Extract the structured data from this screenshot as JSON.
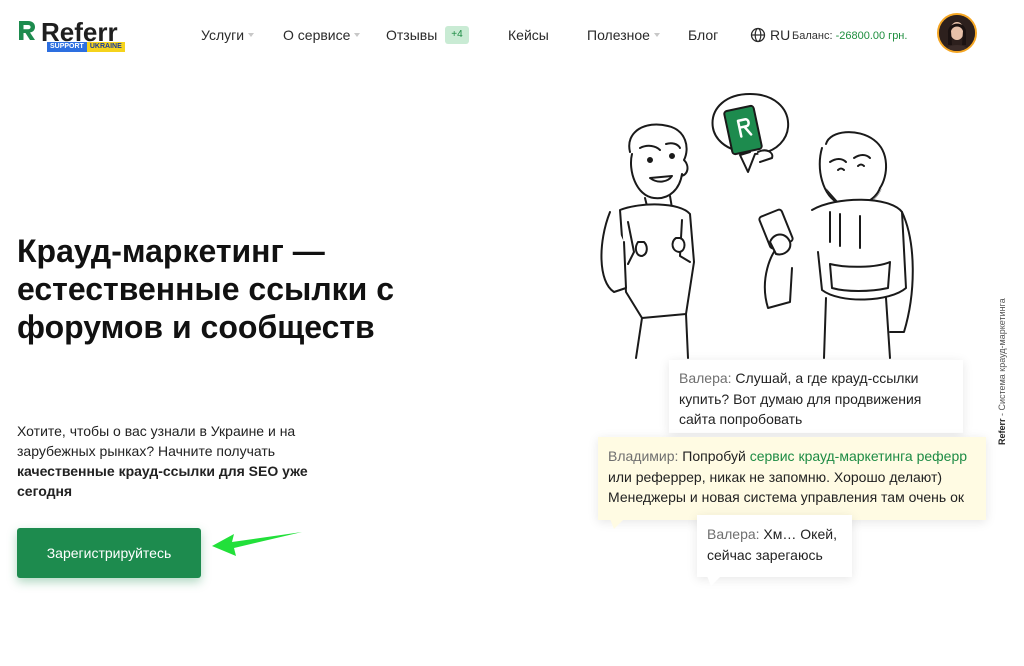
{
  "brand": {
    "name": "Referr",
    "badge_left": "SUPPORT",
    "badge_right": "UKRAINE",
    "accent": "#1d8b4e"
  },
  "nav": {
    "items": [
      {
        "label": "Услуги",
        "dropdown": true
      },
      {
        "label": "О сервисе",
        "dropdown": true
      },
      {
        "label": "Отзывы",
        "dropdown": false,
        "badge": "+4"
      },
      {
        "label": "Кейсы",
        "dropdown": false
      },
      {
        "label": "Полезное",
        "dropdown": true
      },
      {
        "label": "Блог",
        "dropdown": false
      }
    ],
    "language": "RU",
    "balance_label": "Баланс:",
    "balance_value": "-26800.00 грн."
  },
  "hero": {
    "title": "Крауд-маркетинг — естественные ссылки с форумов и сообществ",
    "text_plain": "Хотите, чтобы о вас узнали в Украине и на зарубежных рынках? Начните получать ",
    "text_bold": "качественные крауд-ссылки для SEO уже сегодня",
    "cta_label": "Зарегистрируйтесь"
  },
  "side_label": {
    "brand": "Referr",
    "text": " - Система крауд-маркетинга"
  },
  "chat": {
    "bubble1": {
      "speaker": "Валера:",
      "text": " Слушай, а где крауд-ссылки купить? Вот думаю для продвижения сайта попробовать"
    },
    "bubble2": {
      "speaker": "Владимир:",
      "text_before": " Попробуй ",
      "link": "сервис крауд-маркетинга реферр",
      "text_after": " или рефеpрер, никак не запомню. Хорошо делают) Менеджеры и новая система управления там очень ок"
    },
    "bubble3": {
      "speaker": "Валера:",
      "text": " Хм… Окей, сейчас зарегаюсь"
    }
  },
  "icons": {
    "logo": "referr-logo-icon",
    "globe": "globe-icon",
    "avatar": "user-avatar",
    "arrow": "pointer-arrow-icon",
    "illustration": "two-guys-phone-illustration"
  }
}
